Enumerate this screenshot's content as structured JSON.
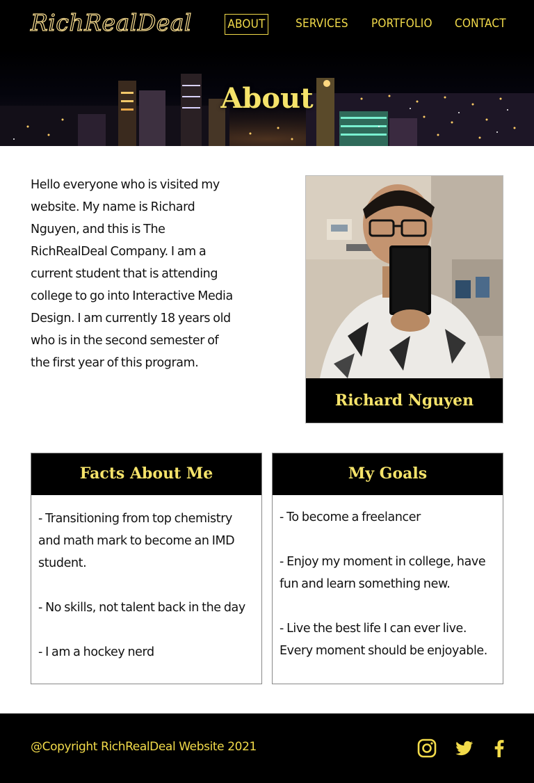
{
  "brand": {
    "logo_text": "RichRealDeal"
  },
  "nav": {
    "items": [
      {
        "label": "ABOUT",
        "active": true
      },
      {
        "label": "SERVICES",
        "active": false
      },
      {
        "label": "PORTFOLIO",
        "active": false
      },
      {
        "label": "CONTACT",
        "active": false
      }
    ]
  },
  "hero": {
    "title": "About"
  },
  "intro": {
    "text": "Hello everyone who is visited my website. My name is Richard Nguyen, and  this is The RichRealDeal Company. I am a current student that is attending college to go into Interactive Media Design. I am currently 18 years old who is in the second semester of the first year of this program."
  },
  "profile": {
    "name": "Richard Nguyen"
  },
  "facts": {
    "title": "Facts About Me",
    "items": [
      "- Transitioning from top chemistry and math mark to become an IMD student.",
      "- No skills, not talent back in the day",
      "- I am a hockey nerd"
    ]
  },
  "goals": {
    "title": "My Goals",
    "items": [
      "- To become a freelancer",
      "- Enjoy my moment in college, have fun and learn something new.",
      "- Live the best life I can ever live. Every moment should be enjoyable."
    ]
  },
  "footer": {
    "copyright": "@Copyright RichRealDeal Website 2021",
    "social_icons": [
      "instagram-icon",
      "twitter-icon",
      "facebook-icon"
    ]
  },
  "colors": {
    "accent": "#f2db4a",
    "background_dark": "#000000"
  }
}
